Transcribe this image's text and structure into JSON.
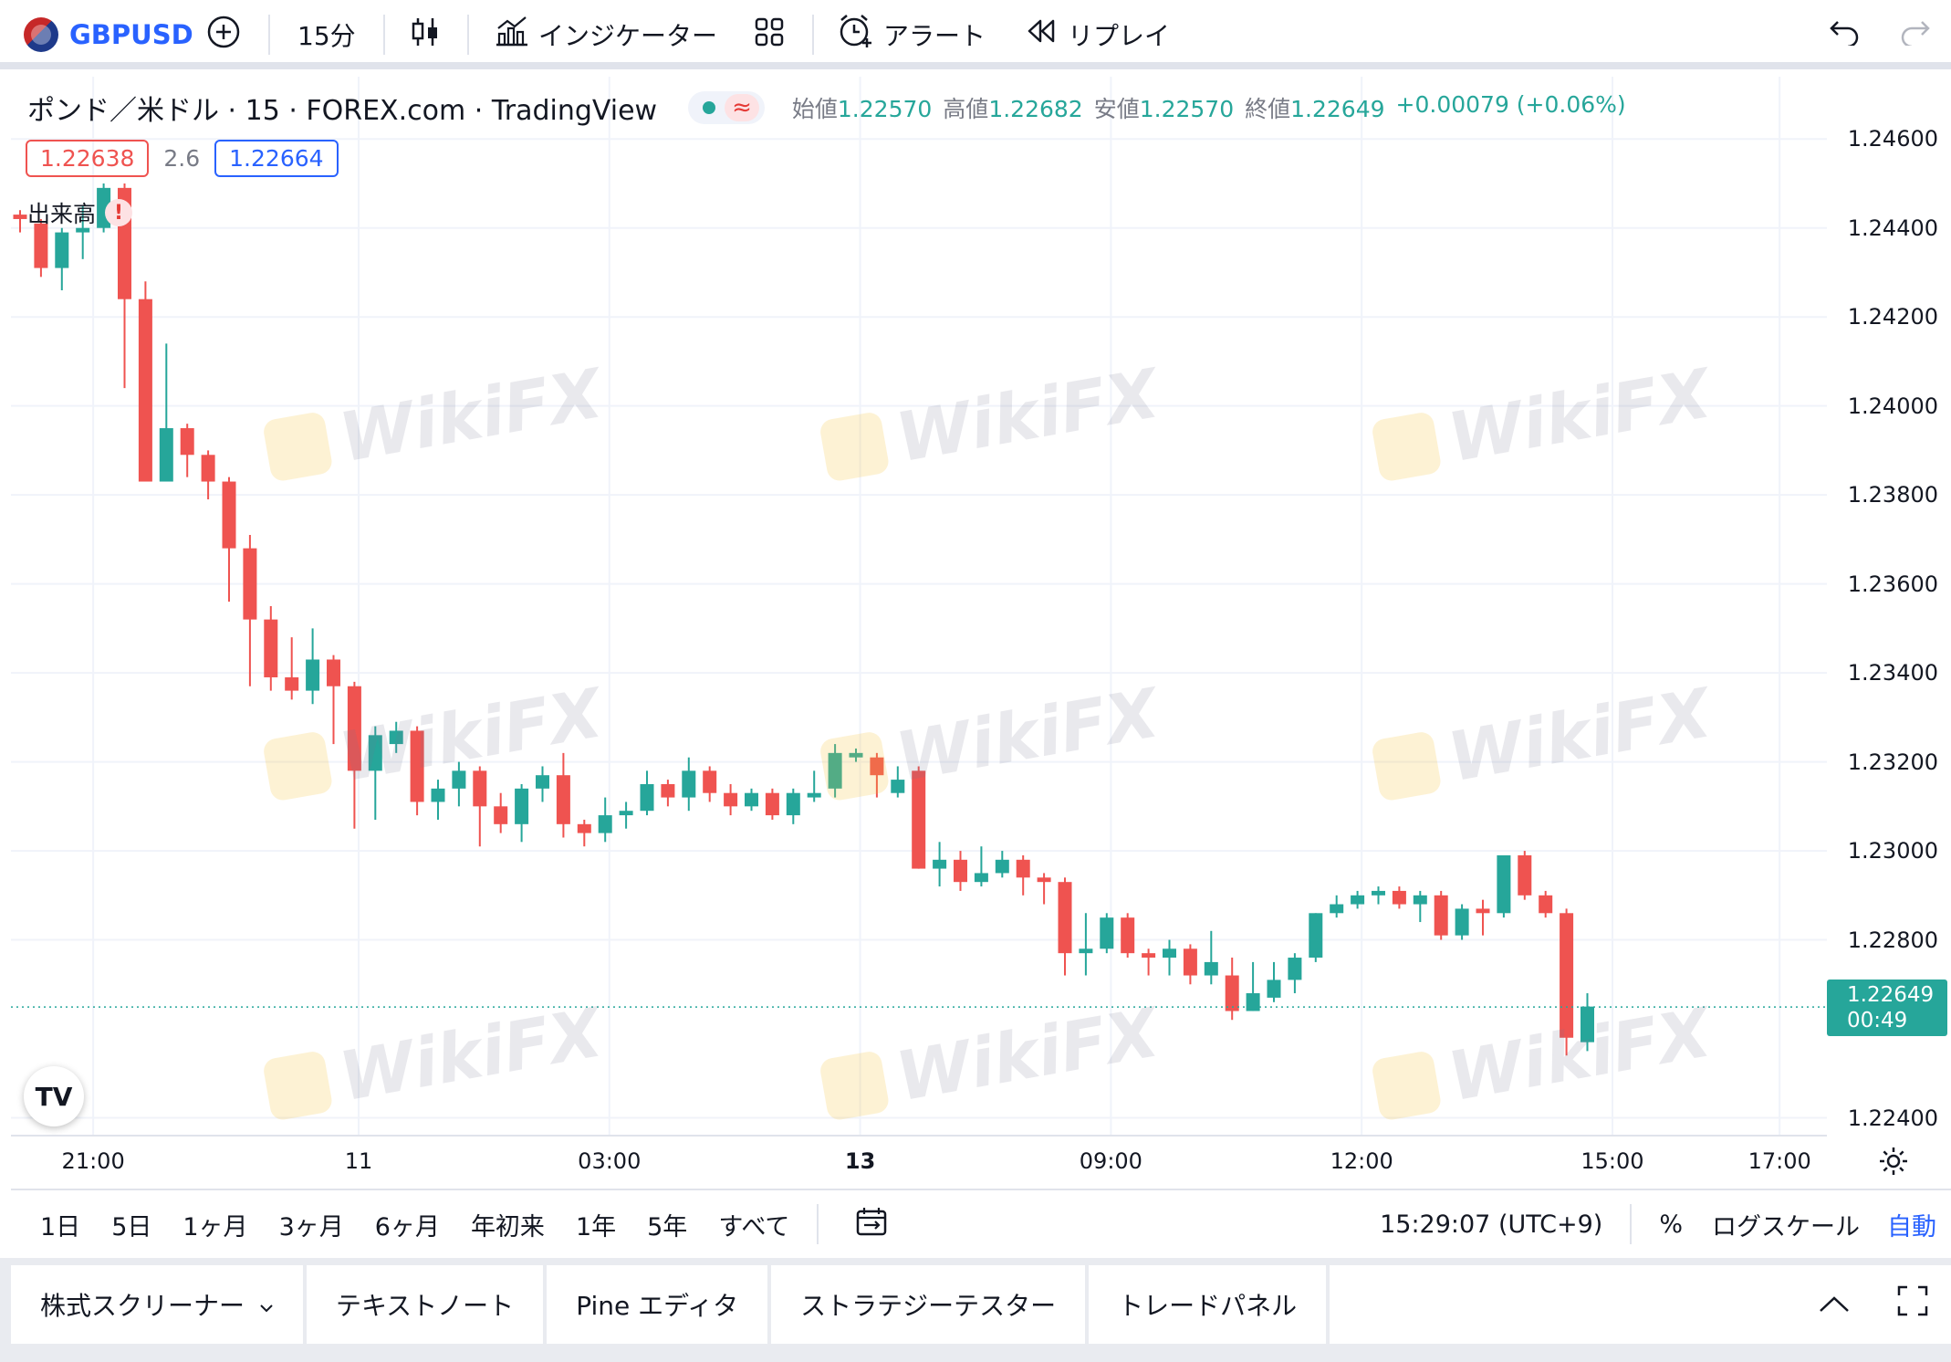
{
  "toolbar": {
    "symbol": "GBPUSD",
    "interval": "15分",
    "indicators": "インジケーター",
    "alert": "アラート",
    "replay": "リプレイ"
  },
  "legend": {
    "title": "ポンド／米ドル · 15 · FOREX.com · TradingView",
    "wave": "≈",
    "open_label": "始値",
    "open": "1.22570",
    "high_label": "高値",
    "high": "1.22682",
    "low_label": "安値",
    "low": "1.22570",
    "close_label": "終値",
    "close": "1.22649",
    "change": "+0.00079 (+0.06%)"
  },
  "quote": {
    "bid": "1.22638",
    "spread": "2.6",
    "ask": "1.22664"
  },
  "volume_label": "出来高",
  "warning_glyph": "!",
  "current_price": {
    "price": "1.22649",
    "countdown": "00:49"
  },
  "logo_text": "TV",
  "watermark": "WikiFX",
  "colors": {
    "up": "#26a69a",
    "down": "#ef5350",
    "accent": "#2962ff"
  },
  "icons": {
    "add": "plus-circle-icon",
    "chart_type": "candlestick-icon",
    "indicators": "indicator-chart-icon",
    "layout": "grid-layout-icon",
    "alert": "alarm-clock-icon",
    "replay": "rewind-icon",
    "undo": "undo-icon",
    "redo": "redo-icon",
    "settings": "gear-icon",
    "date_range": "calendar-range-icon",
    "collapse": "chevron-up-icon",
    "fullscreen": "fullscreen-icon"
  },
  "range_bar": {
    "ranges": [
      "1日",
      "5日",
      "1ヶ月",
      "3ヶ月",
      "6ヶ月",
      "年初来",
      "1年",
      "5年",
      "すべて"
    ],
    "clock": "15:29:07 (UTC+9)",
    "percent": "%",
    "log_scale": "ログスケール",
    "auto": "自動"
  },
  "bottom_tabs": [
    "株式スクリーナー",
    "テキストノート",
    "Pine エディタ",
    "ストラテジーテスター",
    "トレードパネル"
  ],
  "chart_data": {
    "type": "candlestick",
    "price_axis_ticks": [
      "1.24600",
      "1.24400",
      "1.24200",
      "1.24000",
      "1.23800",
      "1.23600",
      "1.23400",
      "1.23200",
      "1.23000",
      "1.22800",
      "1.22400"
    ],
    "price_axis_values": [
      1.246,
      1.244,
      1.242,
      1.24,
      1.238,
      1.236,
      1.234,
      1.232,
      1.23,
      1.228,
      1.224
    ],
    "ylim": [
      1.2236,
      1.2474
    ],
    "time_axis_ticks": [
      "21:00",
      "11",
      "03:00",
      "13",
      "09:00",
      "12:00",
      "15:00",
      "17:00"
    ],
    "time_axis_index": [
      3.5,
      16.2,
      28.2,
      40.2,
      52.2,
      64.2,
      76.2,
      84.2
    ],
    "bold_ticks": [
      "13"
    ],
    "grid": true,
    "last_price": 1.22649,
    "candles": [
      [
        1.2443,
        1.2444,
        1.2439,
        1.2442
      ],
      [
        1.2441,
        1.2442,
        1.2429,
        1.2431
      ],
      [
        1.2431,
        1.244,
        1.2426,
        1.2439
      ],
      [
        1.2439,
        1.2445,
        1.2433,
        1.244
      ],
      [
        1.244,
        1.245,
        1.2439,
        1.2449
      ],
      [
        1.2449,
        1.245,
        1.2404,
        1.2424
      ],
      [
        1.2424,
        1.2428,
        1.2383,
        1.2383
      ],
      [
        1.2383,
        1.2414,
        1.2383,
        1.2395
      ],
      [
        1.2395,
        1.2396,
        1.2384,
        1.2389
      ],
      [
        1.2389,
        1.239,
        1.2379,
        1.2383
      ],
      [
        1.2383,
        1.2384,
        1.2356,
        1.2368
      ],
      [
        1.2368,
        1.2371,
        1.2337,
        1.2352
      ],
      [
        1.2352,
        1.2355,
        1.2336,
        1.2339
      ],
      [
        1.2339,
        1.2348,
        1.2334,
        1.2336
      ],
      [
        1.2336,
        1.235,
        1.2333,
        1.2343
      ],
      [
        1.2343,
        1.2344,
        1.2324,
        1.2337
      ],
      [
        1.2337,
        1.2338,
        1.2305,
        1.2318
      ],
      [
        1.2318,
        1.2328,
        1.2307,
        1.2326
      ],
      [
        1.2324,
        1.2329,
        1.2322,
        1.2327
      ],
      [
        1.2327,
        1.2328,
        1.2308,
        1.2311
      ],
      [
        1.2311,
        1.2316,
        1.2307,
        1.2314
      ],
      [
        1.2314,
        1.232,
        1.231,
        1.2318
      ],
      [
        1.2318,
        1.2319,
        1.2301,
        1.231
      ],
      [
        1.231,
        1.2313,
        1.2304,
        1.2306
      ],
      [
        1.2306,
        1.2315,
        1.2302,
        1.2314
      ],
      [
        1.2314,
        1.2319,
        1.2311,
        1.2317
      ],
      [
        1.2317,
        1.2322,
        1.2303,
        1.2306
      ],
      [
        1.2306,
        1.2307,
        1.2301,
        1.2304
      ],
      [
        1.2304,
        1.2312,
        1.2302,
        1.2308
      ],
      [
        1.2308,
        1.2311,
        1.2305,
        1.2309
      ],
      [
        1.2309,
        1.2318,
        1.2308,
        1.2315
      ],
      [
        1.2315,
        1.2316,
        1.231,
        1.2312
      ],
      [
        1.2312,
        1.2321,
        1.2309,
        1.2318
      ],
      [
        1.2318,
        1.2319,
        1.2311,
        1.2313
      ],
      [
        1.2313,
        1.2315,
        1.2308,
        1.231
      ],
      [
        1.231,
        1.2314,
        1.2309,
        1.2313
      ],
      [
        1.2313,
        1.2314,
        1.2307,
        1.2308
      ],
      [
        1.2308,
        1.2314,
        1.2306,
        1.2313
      ],
      [
        1.2312,
        1.2318,
        1.2311,
        1.2313
      ],
      [
        1.2314,
        1.2324,
        1.2312,
        1.2322
      ],
      [
        1.2321,
        1.2323,
        1.232,
        1.2322
      ],
      [
        1.2321,
        1.2322,
        1.2312,
        1.2317
      ],
      [
        1.2313,
        1.2319,
        1.2312,
        1.2316
      ],
      [
        1.2318,
        1.2319,
        1.2296,
        1.2296
      ],
      [
        1.2296,
        1.2302,
        1.2292,
        1.2298
      ],
      [
        1.2298,
        1.23,
        1.2291,
        1.2293
      ],
      [
        1.2293,
        1.2301,
        1.2292,
        1.2295
      ],
      [
        1.2295,
        1.23,
        1.2294,
        1.2298
      ],
      [
        1.2298,
        1.2299,
        1.229,
        1.2294
      ],
      [
        1.2294,
        1.2295,
        1.2288,
        1.2293
      ],
      [
        1.2293,
        1.2294,
        1.2272,
        1.2277
      ],
      [
        1.2277,
        1.2286,
        1.2272,
        1.2278
      ],
      [
        1.2278,
        1.2286,
        1.2277,
        1.2285
      ],
      [
        1.2285,
        1.2286,
        1.2276,
        1.2277
      ],
      [
        1.2277,
        1.2278,
        1.2272,
        1.2276
      ],
      [
        1.2276,
        1.228,
        1.2272,
        1.2278
      ],
      [
        1.2278,
        1.2279,
        1.227,
        1.2272
      ],
      [
        1.2272,
        1.2282,
        1.227,
        1.2275
      ],
      [
        1.2272,
        1.2276,
        1.2262,
        1.2264
      ],
      [
        1.2264,
        1.2275,
        1.2264,
        1.2268
      ],
      [
        1.2267,
        1.2275,
        1.2266,
        1.2271
      ],
      [
        1.2271,
        1.2277,
        1.2268,
        1.2276
      ],
      [
        1.2276,
        1.2286,
        1.2275,
        1.2286
      ],
      [
        1.2286,
        1.229,
        1.2285,
        1.2288
      ],
      [
        1.2288,
        1.2291,
        1.2287,
        1.229
      ],
      [
        1.229,
        1.2292,
        1.2288,
        1.2291
      ],
      [
        1.2291,
        1.2292,
        1.2287,
        1.2288
      ],
      [
        1.2288,
        1.2291,
        1.2284,
        1.229
      ],
      [
        1.229,
        1.2291,
        1.228,
        1.2281
      ],
      [
        1.2281,
        1.2288,
        1.228,
        1.2287
      ],
      [
        1.2287,
        1.2289,
        1.2281,
        1.2286
      ],
      [
        1.2286,
        1.2299,
        1.2285,
        1.2299
      ],
      [
        1.2299,
        1.23,
        1.2289,
        1.229
      ],
      [
        1.229,
        1.2291,
        1.2285,
        1.2286
      ],
      [
        1.2286,
        1.2287,
        1.2254,
        1.2258
      ],
      [
        1.2257,
        1.2268,
        1.2255,
        1.2265
      ]
    ]
  }
}
